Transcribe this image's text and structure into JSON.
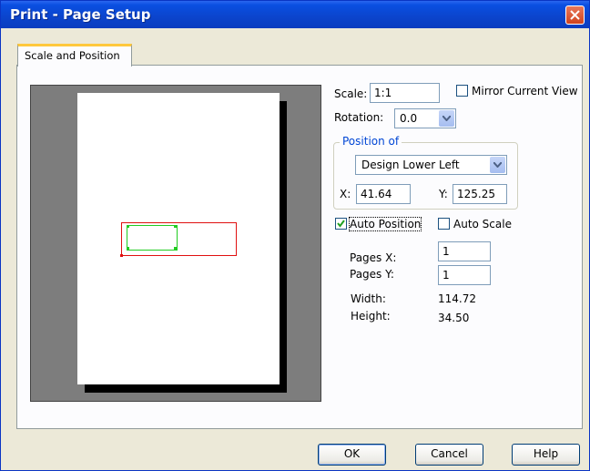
{
  "window": {
    "title": "Print - Page Setup",
    "close_symbol": "×"
  },
  "tabs": [
    {
      "label": "Scale and Position",
      "selected": true
    }
  ],
  "scale": {
    "label": "Scale:",
    "value": "1:1"
  },
  "mirror": {
    "label": "Mirror Current View",
    "checked": false
  },
  "rotation": {
    "label": "Rotation:",
    "value": "0.0"
  },
  "position_of": {
    "legend": "Position of",
    "selected": "Design Lower Left",
    "x_label": "X:",
    "x_value": "41.64",
    "y_label": "Y:",
    "y_value": "125.25"
  },
  "auto_position": {
    "label": "Auto Position",
    "checked": true
  },
  "auto_scale": {
    "label": "Auto Scale",
    "checked": false
  },
  "pages_x": {
    "label": "Pages X:",
    "value": "1"
  },
  "pages_y": {
    "label": "Pages Y:",
    "value": "1"
  },
  "width": {
    "label": "Width:",
    "value": "114.72"
  },
  "height": {
    "label": "Height:",
    "value": "34.50"
  },
  "buttons": {
    "ok": "OK",
    "cancel": "Cancel",
    "help": "Help"
  },
  "colors": {
    "titlebar": "#0a4fe1",
    "preview_bg": "#7d7d7d",
    "plot_area": "#e01010",
    "design": "#22cc22",
    "tab_accent": "#ffc83c"
  }
}
